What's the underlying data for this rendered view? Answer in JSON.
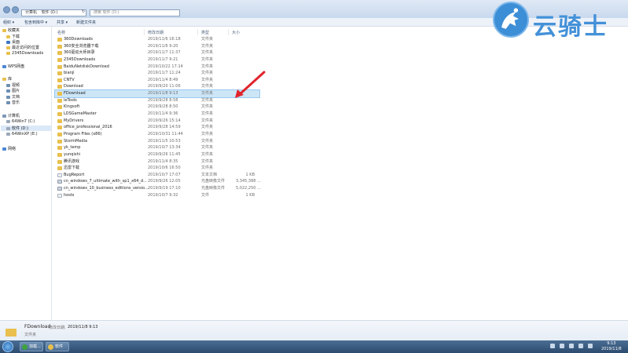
{
  "address": {
    "segments": [
      "计算机",
      "软件 (D:)"
    ]
  },
  "search": {
    "placeholder": "搜索 软件 (D:)"
  },
  "toolbar": {
    "organize": "组织 ▾",
    "include": "包含到库中 ▾",
    "share": "共享 ▾",
    "new_folder": "新建文件夹"
  },
  "sidebar": {
    "favorites": [
      {
        "label": "收藏夹",
        "color": "#e9c04e"
      },
      {
        "label": "下载",
        "color": "#e9c04e"
      },
      {
        "label": "桌面",
        "color": "#3c78c4"
      },
      {
        "label": "最近访问的位置",
        "color": "#e9c04e"
      },
      {
        "label": "2345Downloads",
        "color": "#e9c04e"
      }
    ],
    "wps": {
      "label": "WPS网盘",
      "color": "#4a86d4"
    },
    "libraries": [
      {
        "label": "库",
        "color": "#e9c04e"
      },
      {
        "label": "视频",
        "color": "#6d8fb4"
      },
      {
        "label": "图片",
        "color": "#6d8fb4"
      },
      {
        "label": "文档",
        "color": "#6d8fb4"
      },
      {
        "label": "音乐",
        "color": "#6d8fb4"
      }
    ],
    "computer": [
      {
        "label": "计算机",
        "color": "#7e98b8"
      },
      {
        "label": "64Win7 (C:)",
        "color": "#9aa8b8"
      },
      {
        "label": "软件 (D:)",
        "color": "#9aa8b8"
      },
      {
        "label": "64WinXP (E:)",
        "color": "#9aa8b8"
      }
    ],
    "network": {
      "label": "网络",
      "color": "#4a86d4"
    }
  },
  "columns": {
    "name": "名称",
    "date": "修改日期",
    "type": "类型",
    "size": "大小"
  },
  "files": [
    {
      "name": "360Downloads",
      "date": "2019/11/6 16:18",
      "type": "文件夹",
      "size": "",
      "kind": "folder"
    },
    {
      "name": "360安全浏览器下载",
      "date": "2019/11/6 9:20",
      "type": "文件夹",
      "size": "",
      "kind": "folder"
    },
    {
      "name": "360驱动大师目录",
      "date": "2019/11/7 11:37",
      "type": "文件夹",
      "size": "",
      "kind": "folder"
    },
    {
      "name": "2345Downloads",
      "date": "2019/11/7 9:21",
      "type": "文件夹",
      "size": "",
      "kind": "folder"
    },
    {
      "name": "BaiduNetdiskDownload",
      "date": "2019/10/22 17:14",
      "type": "文件夹",
      "size": "",
      "kind": "folder"
    },
    {
      "name": "bianji",
      "date": "2019/11/7 11:24",
      "type": "文件夹",
      "size": "",
      "kind": "folder"
    },
    {
      "name": "CNTV",
      "date": "2019/11/4 8:49",
      "type": "文件夹",
      "size": "",
      "kind": "folder"
    },
    {
      "name": "Download",
      "date": "2019/9/20 11:06",
      "type": "文件夹",
      "size": "",
      "kind": "folder"
    },
    {
      "name": "FDownload",
      "date": "2019/11/8 9:13",
      "type": "文件夹",
      "size": "",
      "kind": "folder"
    },
    {
      "name": "ieTools",
      "date": "2019/9/28 8:58",
      "type": "文件夹",
      "size": "",
      "kind": "folder"
    },
    {
      "name": "Kingsoft",
      "date": "2019/9/28 8:50",
      "type": "文件夹",
      "size": "",
      "kind": "folder"
    },
    {
      "name": "LDSGameMaster",
      "date": "2019/11/4 9:36",
      "type": "文件夹",
      "size": "",
      "kind": "folder"
    },
    {
      "name": "MyDrivers",
      "date": "2019/9/26 15:14",
      "type": "文件夹",
      "size": "",
      "kind": "folder"
    },
    {
      "name": "office_professional_2016",
      "date": "2019/9/28 14:59",
      "type": "文件夹",
      "size": "",
      "kind": "folder"
    },
    {
      "name": "Program Files (x86)",
      "date": "2019/10/31 11:44",
      "type": "文件夹",
      "size": "",
      "kind": "folder"
    },
    {
      "name": "StormMedia",
      "date": "2019/11/5 10:53",
      "type": "文件夹",
      "size": "",
      "kind": "folder"
    },
    {
      "name": "yk_temp",
      "date": "2019/10/7 13:34",
      "type": "文件夹",
      "size": "",
      "kind": "folder"
    },
    {
      "name": "yunqishi",
      "date": "2019/9/26 11:45",
      "type": "文件夹",
      "size": "",
      "kind": "folder"
    },
    {
      "name": "腾讯游戏",
      "date": "2019/11/4 8:35",
      "type": "文件夹",
      "size": "",
      "kind": "folder"
    },
    {
      "name": "迅雷下载",
      "date": "2019/10/6 16:50",
      "type": "文件夹",
      "size": "",
      "kind": "folder"
    },
    {
      "name": "BugReport",
      "date": "2019/10/7 17:07",
      "type": "文本文档",
      "size": "1 KB",
      "kind": "file"
    },
    {
      "name": "cn_windows_7_ultimate_with_sp1_x64_d...",
      "date": "2019/9/26 12:05",
      "type": "光盘映像文件",
      "size": "3,345,388 ...",
      "kind": "iso"
    },
    {
      "name": "cn_windows_10_business_editions_versio...",
      "date": "2019/9/19 17:10",
      "type": "光盘映像文件",
      "size": "5,022,250 ...",
      "kind": "iso"
    },
    {
      "name": "hosts",
      "date": "2019/10/7 9:32",
      "type": "文件",
      "size": "1 KB",
      "kind": "file"
    }
  ],
  "details": {
    "name": "FDownload",
    "label": "修改日期:",
    "value": "2019/11/8 9:13",
    "type": "文件夹"
  },
  "taskbar": {
    "items": [
      {
        "label": "加载...",
        "color": "#3da33d"
      },
      {
        "label": "软件",
        "color": "#e9c04e"
      }
    ],
    "time": "9:13",
    "date": "2019/11/8"
  },
  "watermark": {
    "text": "云骑士"
  },
  "colors": {
    "selection": "#cde6f7",
    "arrow": "#e0242b",
    "brand": "#4491d8"
  }
}
